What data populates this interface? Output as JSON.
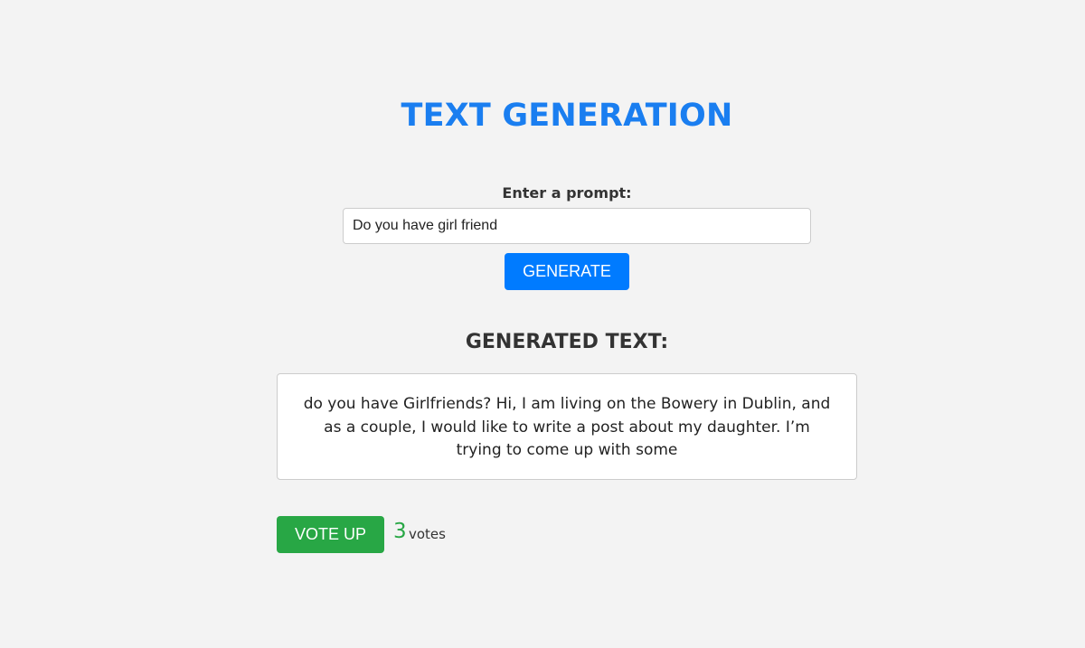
{
  "page": {
    "title": "TEXT GENERATION"
  },
  "prompt": {
    "label": "Enter a prompt:",
    "value": "Do you have girl friend",
    "generate_label": "GENERATE"
  },
  "output": {
    "heading": "GENERATED TEXT:",
    "text": "do you have Girlfriends? Hi, I am living on the Bowery in Dublin, and as a couple, I would like to write a post about my daughter. I’m trying to come up with some"
  },
  "voting": {
    "button_label": "VOTE UP",
    "count": "3",
    "unit": "votes"
  },
  "colors": {
    "accent": "#007bff",
    "title": "#1a7ef0",
    "vote": "#28a745",
    "background": "#f3f3f3"
  }
}
